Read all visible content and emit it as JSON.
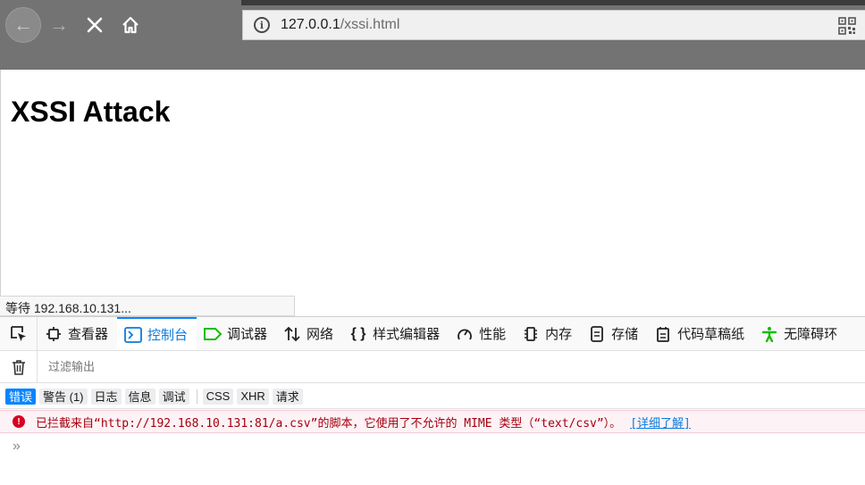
{
  "browser": {
    "url_host": "127.0.0.1",
    "url_path": "/xssi.html"
  },
  "page": {
    "title": "XSSI Attack"
  },
  "status": {
    "text": "等待 192.168.10.131..."
  },
  "devtools": {
    "tabs": [
      {
        "label": "查看器",
        "icon": "inspector-icon"
      },
      {
        "label": "控制台",
        "icon": "console-icon"
      },
      {
        "label": "调试器",
        "icon": "debugger-icon"
      },
      {
        "label": "网络",
        "icon": "network-icon"
      },
      {
        "label": "样式编辑器",
        "icon": "style-editor-icon"
      },
      {
        "label": "性能",
        "icon": "performance-icon"
      },
      {
        "label": "内存",
        "icon": "memory-icon"
      },
      {
        "label": "存储",
        "icon": "storage-icon"
      },
      {
        "label": "代码草稿纸",
        "icon": "scratchpad-icon"
      },
      {
        "label": "无障碍环",
        "icon": "accessibility-icon"
      }
    ],
    "filter_placeholder": "过滤输出",
    "levels": [
      "错误",
      "警告 (1)",
      "日志",
      "信息",
      "调试"
    ],
    "categories": [
      "CSS",
      "XHR",
      "请求"
    ],
    "error_message": "已拦截来自“http://192.168.10.131:81/a.csv”的脚本，它使用了不允许的 MIME 类型（“text/csv”）。",
    "learn_more": "[详细了解]",
    "prompt_symbol": "»"
  },
  "colors": {
    "accent": "#0a84ff",
    "error": "#d70022",
    "toolbar": "#737373"
  }
}
